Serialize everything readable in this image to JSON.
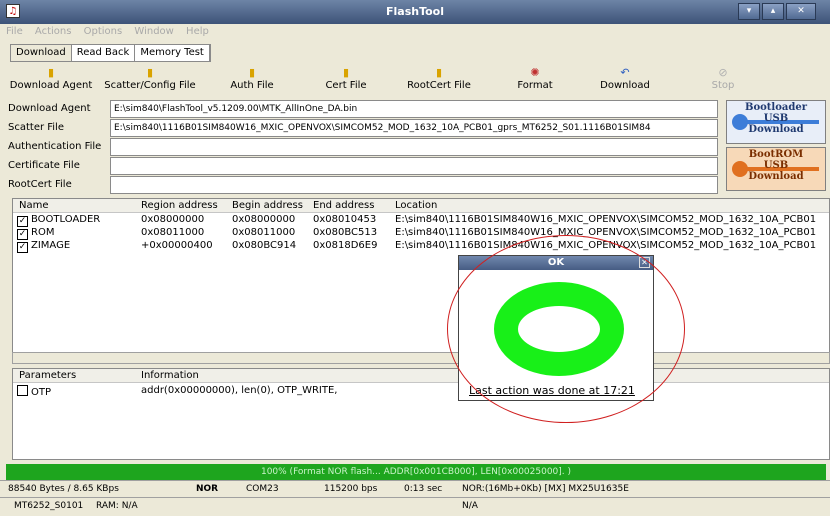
{
  "window": {
    "title": "FlashTool",
    "app_icon_name": "flashtool-icon",
    "buttons": [
      "▾",
      "▴",
      "✕"
    ]
  },
  "menu": [
    "File",
    "Actions",
    "Options",
    "Window",
    "Help"
  ],
  "tabs": [
    "Download",
    "Read Back",
    "Memory Test"
  ],
  "toolbar": [
    "Download Agent",
    "Scatter/Config File",
    "Auth File",
    "Cert File",
    "RootCert File",
    "Format",
    "Download",
    "Stop"
  ],
  "fields": {
    "download_agent": {
      "label": "Download Agent",
      "value": "E:\\sim840\\FlashTool_v5.1209.00\\MTK_AllInOne_DA.bin"
    },
    "scatter": {
      "label": "Scatter File",
      "value": "E:\\sim840\\1116B01SIM840W16_MXIC_OPENVOX\\SIMCOM52_MOD_1632_10A_PCB01_gprs_MT6252_S01.1116B01SIM84"
    },
    "auth": {
      "label": "Authentication File",
      "value": ""
    },
    "cert": {
      "label": "Certificate File",
      "value": ""
    },
    "rootcert": {
      "label": "RootCert File",
      "value": ""
    }
  },
  "side_buttons": {
    "bootloader": {
      "line1": "Bootloader",
      "line2": "USB",
      "line3": "Download"
    },
    "bootrom": {
      "line1": "BootROM",
      "line2": "USB",
      "line3": "Download"
    }
  },
  "regions": {
    "headers": [
      "Name",
      "Region address",
      "Begin address",
      "End address",
      "Location"
    ],
    "rows": [
      {
        "name": "BOOTLOADER",
        "region": "0x08000000",
        "begin": "0x08000000",
        "end": "0x08010453",
        "location": "E:\\sim840\\1116B01SIM840W16_MXIC_OPENVOX\\SIMCOM52_MOD_1632_10A_PCB01"
      },
      {
        "name": "ROM",
        "region": "0x08011000",
        "begin": "0x08011000",
        "end": "0x080BC513",
        "location": "E:\\sim840\\1116B01SIM840W16_MXIC_OPENVOX\\SIMCOM52_MOD_1632_10A_PCB01"
      },
      {
        "name": "ZIMAGE",
        "region": "+0x00000400",
        "begin": "0x080BC914",
        "end": "0x0818D6E9",
        "location": "E:\\sim840\\1116B01SIM840W16_MXIC_OPENVOX\\SIMCOM52_MOD_1632_10A_PCB01"
      }
    ]
  },
  "params": {
    "headers": [
      "Parameters",
      "Information"
    ],
    "rows": [
      {
        "name": "OTP",
        "info": "addr(0x00000000), len(0), OTP_WRITE,"
      }
    ]
  },
  "progress": {
    "text": "100% (Format NOR flash... ADDR[0x001CB000], LEN[0x00025000]. )",
    "fraction": 1.0,
    "color": "#1ea51e"
  },
  "status1": {
    "speed": "88540 Bytes / 8.65 KBps",
    "type": "NOR",
    "port": "COM23",
    "baud": "115200 bps",
    "time": "0:13 sec",
    "flash": "NOR:(16Mb+0Kb) [MX] MX25U1635E"
  },
  "status2": {
    "chip": "MT6252_S0101",
    "ram": "RAM: N/A",
    "extra": "N/A"
  },
  "dialog": {
    "title": "OK",
    "message": "Last action was done at 17:21",
    "ring_color": "#18f018"
  }
}
